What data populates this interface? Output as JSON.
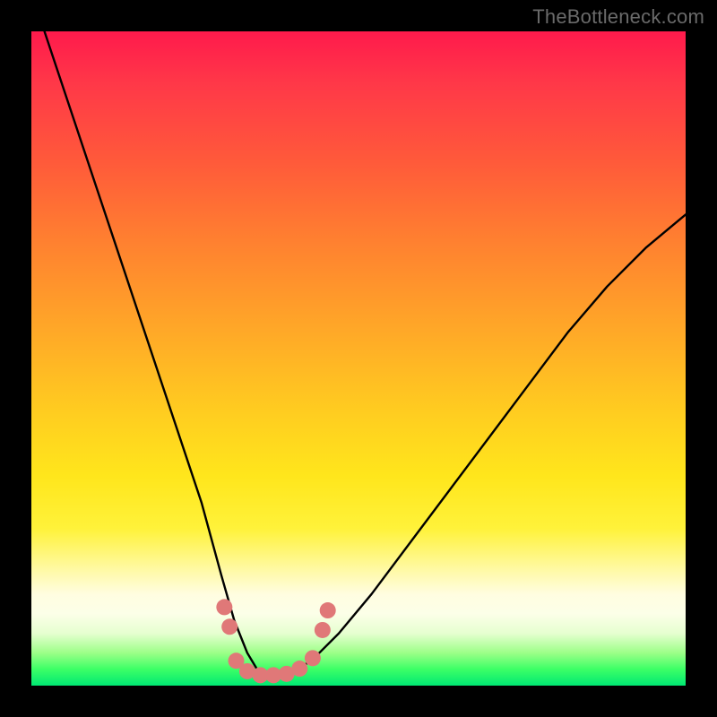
{
  "watermark": {
    "text": "TheBottleneck.com"
  },
  "chart_data": {
    "type": "line",
    "title": "",
    "xlabel": "",
    "ylabel": "",
    "xlim": [
      0,
      100
    ],
    "ylim": [
      0,
      100
    ],
    "grid": false,
    "legend": false,
    "series": [
      {
        "name": "bottleneck-curve",
        "x": [
          2,
          6,
          10,
          14,
          18,
          22,
          26,
          29,
          31,
          33,
          34.5,
          36,
          38,
          40,
          43,
          47,
          52,
          58,
          64,
          70,
          76,
          82,
          88,
          94,
          100
        ],
        "values": [
          100,
          88,
          76,
          64,
          52,
          40,
          28,
          17,
          10,
          5,
          2.5,
          1.5,
          1.5,
          2,
          4,
          8,
          14,
          22,
          30,
          38,
          46,
          54,
          61,
          67,
          72
        ]
      }
    ],
    "markers": [
      {
        "name": "dot",
        "x": 29.5,
        "y": 12
      },
      {
        "name": "dot",
        "x": 30.3,
        "y": 9
      },
      {
        "name": "dot",
        "x": 31.3,
        "y": 3.8
      },
      {
        "name": "dot",
        "x": 33.0,
        "y": 2.2
      },
      {
        "name": "dot",
        "x": 35.0,
        "y": 1.6
      },
      {
        "name": "dot",
        "x": 37.0,
        "y": 1.6
      },
      {
        "name": "dot",
        "x": 39.0,
        "y": 1.8
      },
      {
        "name": "dot",
        "x": 41.0,
        "y": 2.6
      },
      {
        "name": "dot",
        "x": 43.0,
        "y": 4.2
      },
      {
        "name": "dot",
        "x": 44.5,
        "y": 8.5
      },
      {
        "name": "dot",
        "x": 45.3,
        "y": 11.5
      }
    ],
    "colors": {
      "line": "#000000",
      "marker": "#e07878",
      "gradient_top": "#ff1a4c",
      "gradient_bottom": "#00e873"
    }
  }
}
